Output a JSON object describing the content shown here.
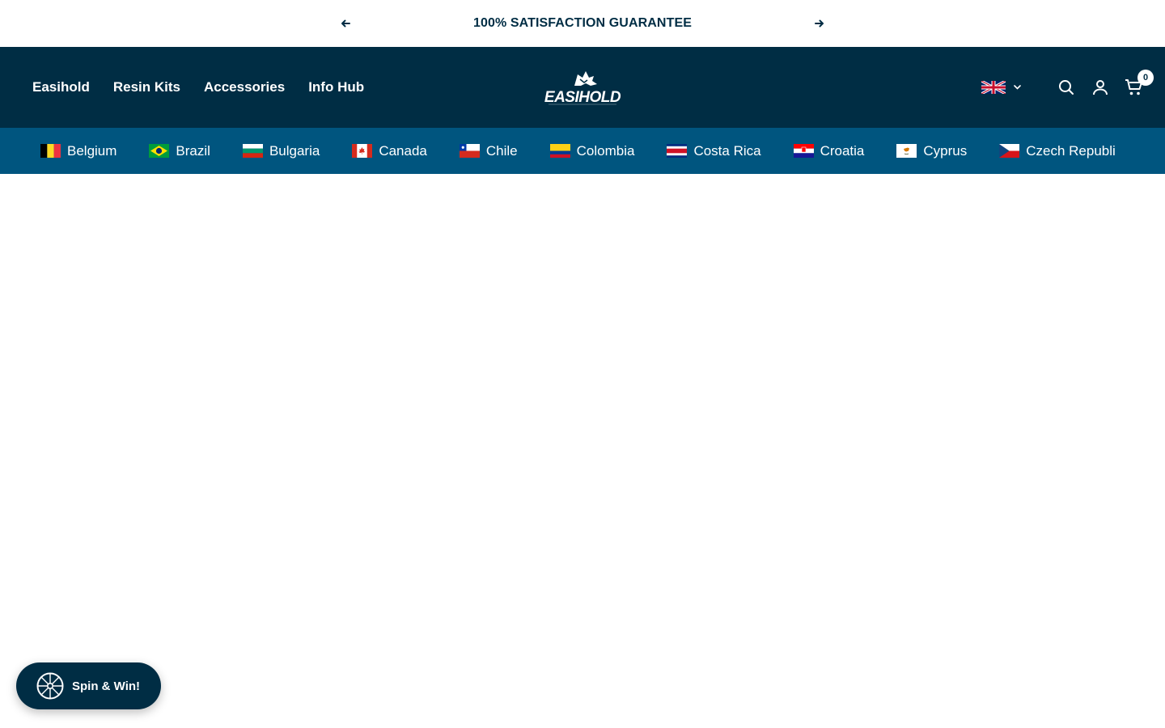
{
  "announcement": {
    "message": "100% SATISFACTION GUARANTEE",
    "prev_icon": "arrow-left-icon",
    "next_icon": "arrow-right-icon"
  },
  "header": {
    "nav": [
      "Easihold",
      "Resin Kits",
      "Accessories",
      "Info Hub"
    ],
    "logo_text": "EASIHOLD",
    "language_flag": "uk-flag-icon",
    "cart_count": "0"
  },
  "countries": [
    "Belgium",
    "Brazil",
    "Bulgaria",
    "Canada",
    "Chile",
    "Colombia",
    "Costa Rica",
    "Croatia",
    "Cyprus",
    "Czech Republi"
  ],
  "spin_widget": {
    "label": "Spin & Win!"
  },
  "colors": {
    "primary": "#002d44",
    "strip": "#00557f",
    "background": "#ffffff"
  }
}
